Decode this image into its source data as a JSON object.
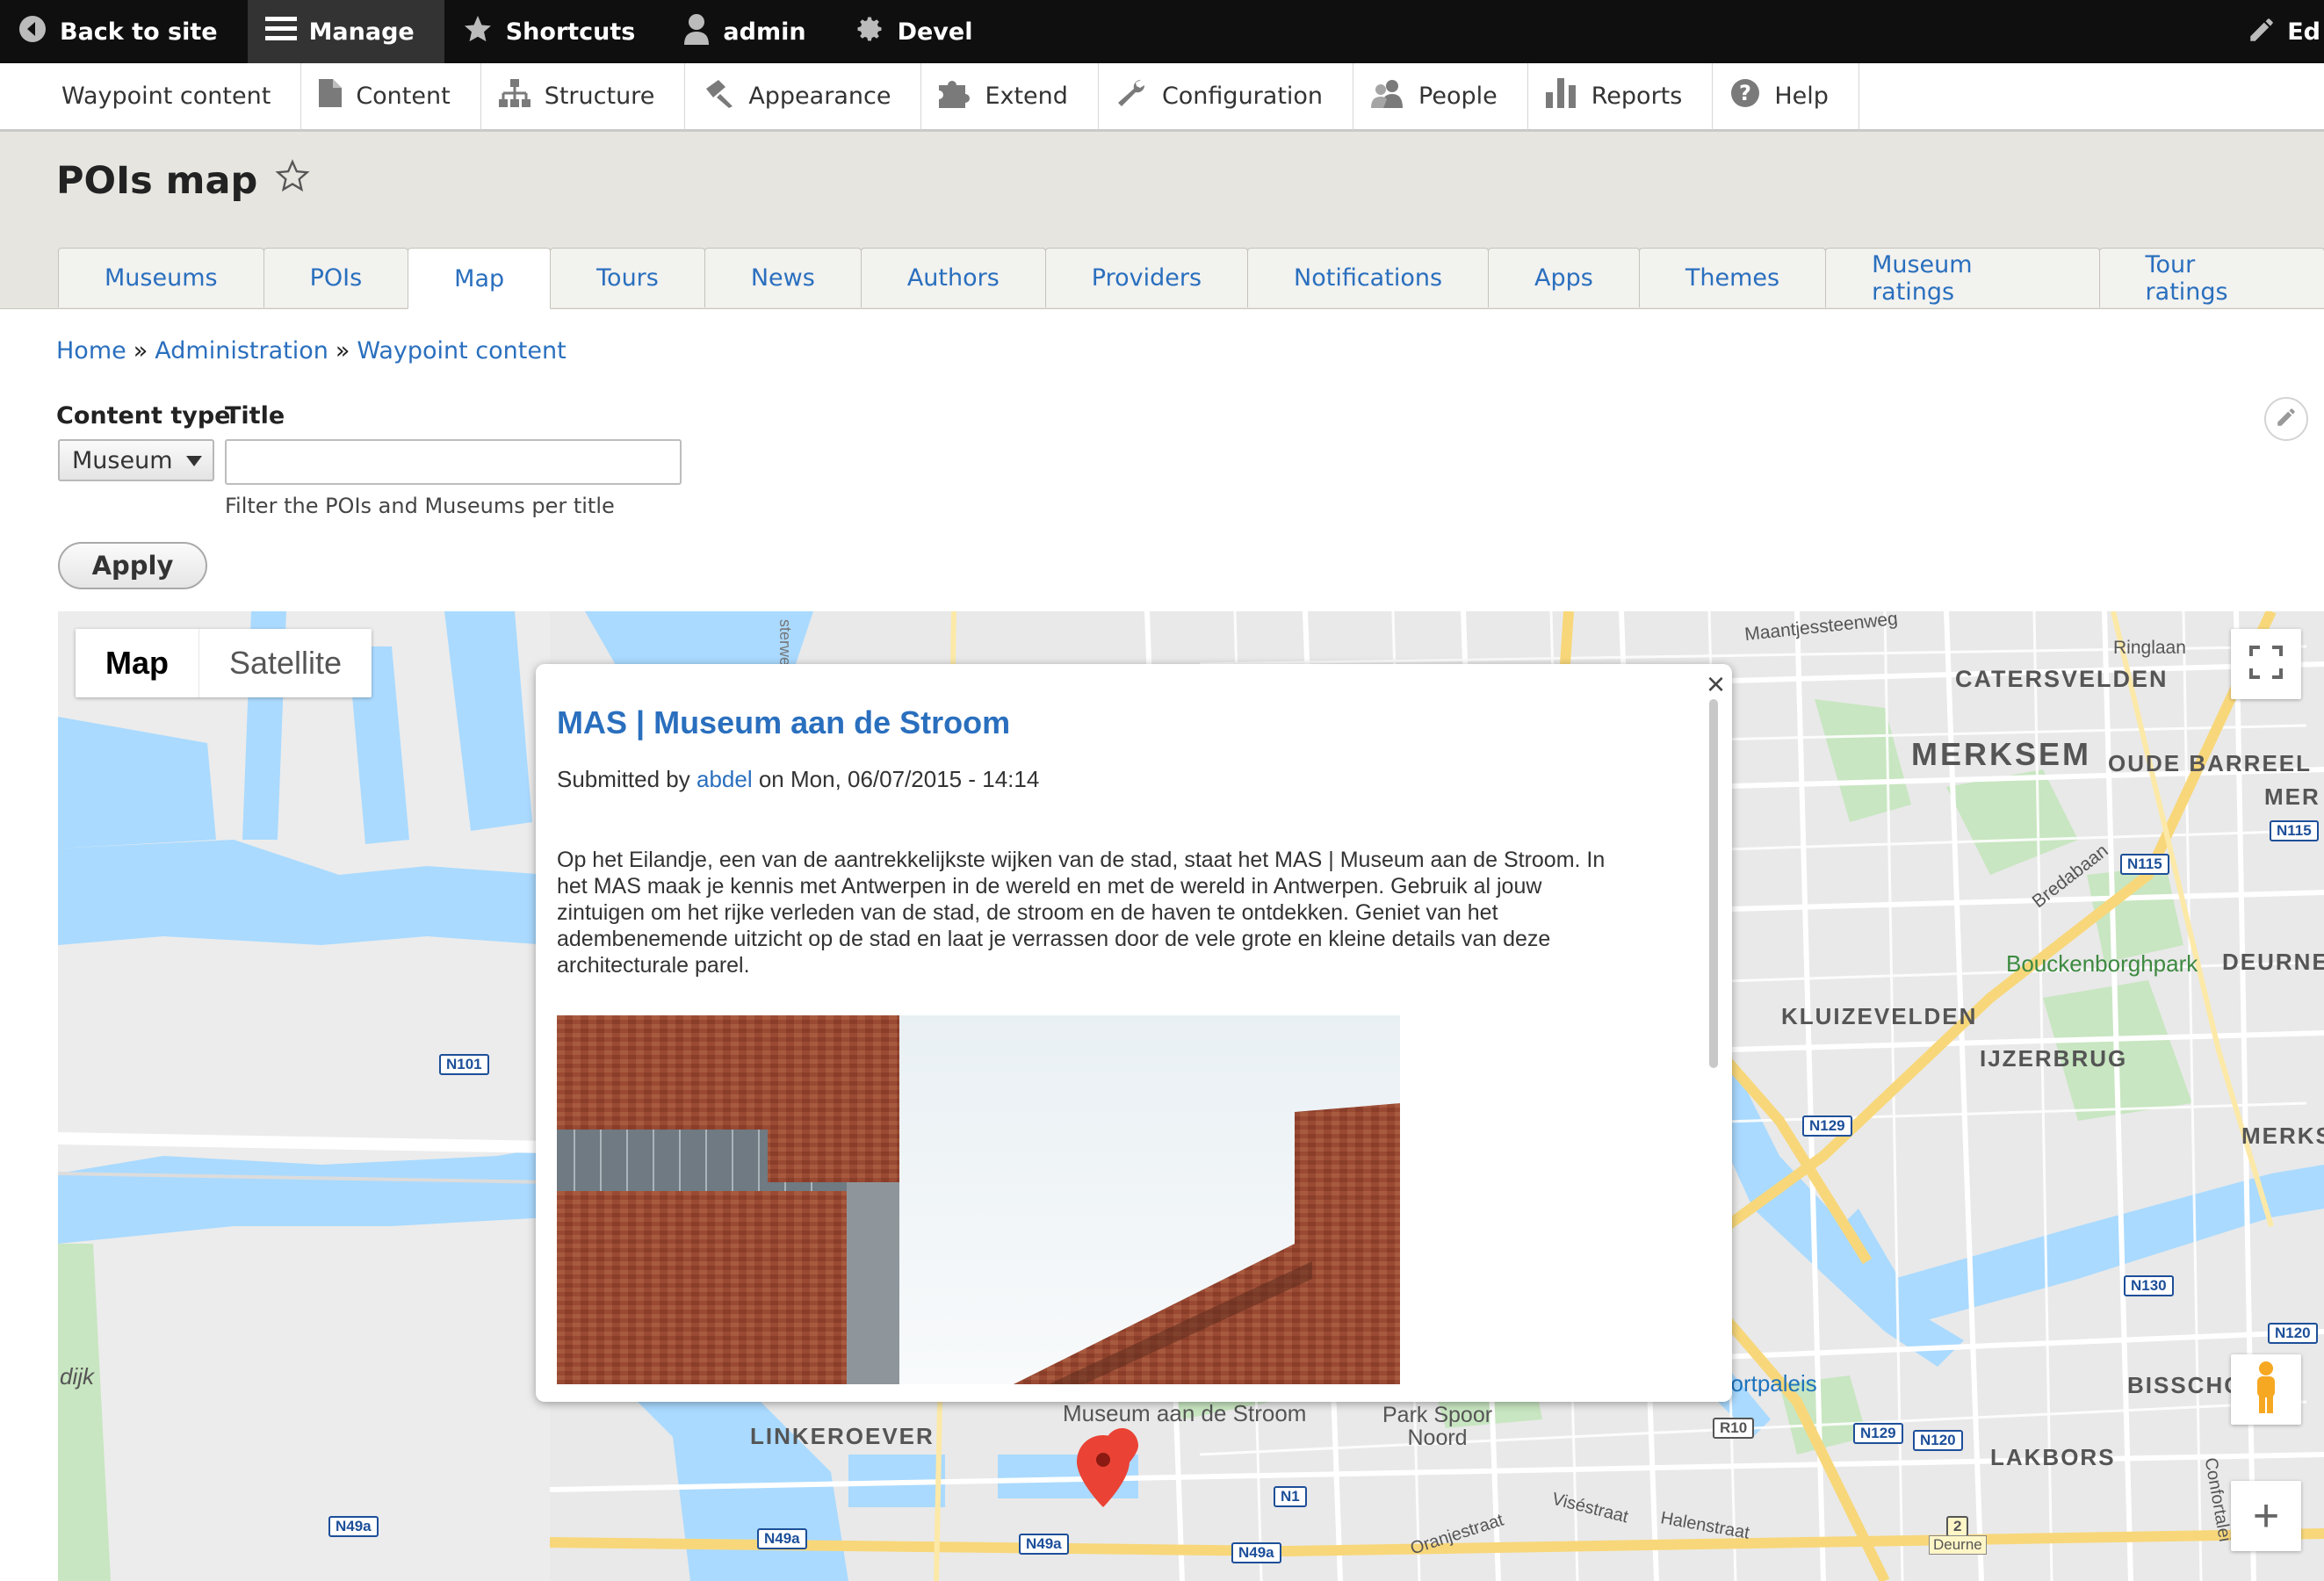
{
  "toolbar": {
    "back_label": "Back to site",
    "manage_label": "Manage",
    "shortcuts_label": "Shortcuts",
    "user_label": "admin",
    "devel_label": "Devel",
    "edit_label": "Ed"
  },
  "menu": {
    "items": [
      {
        "label": "Waypoint content",
        "icon": "none"
      },
      {
        "label": "Content",
        "icon": "file-icon"
      },
      {
        "label": "Structure",
        "icon": "sitemap-icon"
      },
      {
        "label": "Appearance",
        "icon": "paintbrush-icon"
      },
      {
        "label": "Extend",
        "icon": "puzzle-icon"
      },
      {
        "label": "Configuration",
        "icon": "wrench-icon"
      },
      {
        "label": "People",
        "icon": "people-icon"
      },
      {
        "label": "Reports",
        "icon": "bar-chart-icon"
      },
      {
        "label": "Help",
        "icon": "help-icon"
      }
    ]
  },
  "page": {
    "title": "POIs map",
    "tabs": [
      "Museums",
      "POIs",
      "Map",
      "Tours",
      "News",
      "Authors",
      "Providers",
      "Notifications",
      "Apps",
      "Themes",
      "Museum ratings",
      "Tour ratings"
    ],
    "active_tab": "Map"
  },
  "breadcrumb": {
    "home": "Home",
    "admin": "Administration",
    "current": "Waypoint content",
    "sep": "»"
  },
  "filters": {
    "content_type_label": "Content type",
    "content_type_value": "Museum",
    "title_label": "Title",
    "title_value": "",
    "title_description": "Filter the POIs and Museums per title",
    "apply_label": "Apply"
  },
  "map": {
    "type_map": "Map",
    "type_satellite": "Satellite",
    "zoom_in": "+",
    "labels": {
      "maantjessteenweg": "Maantjessteenweg",
      "ringlaan": "Ringlaan",
      "catersvelden": "CATERSVELDEN",
      "merksem": "MERKSEM",
      "oude_barreel": "OUDE BARREEL",
      "mer": "MER",
      "bredabaan": "Bredabaan",
      "bouckenborghpark": "Bouckenborghpark",
      "deurne": "DEURNE",
      "kluizevelden": "KLUIZEVELDEN",
      "ijzerbrug": "IJZERBRUG",
      "merks": "MERKS",
      "sportpaleis": "os Sportpaleis",
      "bissch": "BISSCHO",
      "linkeroever": "LINKEROEVER",
      "museum_aan_de_stroom": "Museum aan de Stroom",
      "park_spoor_noord": "Park Spoor\nNoord",
      "lakbors": "LAKBORS",
      "viseestraat": "Viséstraat",
      "halenstraat": "Halenstraat",
      "oranjestraat": "Oranjestraat",
      "confortalei": "Confortalei",
      "dijk": "dijk",
      "sterweg": "sterweg",
      "deurne_small": "Deurne"
    },
    "shields": [
      "N101",
      "N115",
      "N115",
      "N129",
      "N130",
      "N120",
      "N129",
      "N120",
      "R10",
      "N1",
      "N49a",
      "N49a",
      "N49a",
      "N49a",
      "2"
    ]
  },
  "infowindow": {
    "title": "MAS | Museum aan de Stroom",
    "submitted_prefix": "Submitted by",
    "author": "abdel",
    "submitted_suffix": "on Mon, 06/07/2015 - 14:14",
    "body": "Op het Eilandje, een van de aantrekkelijkste wijken van de stad, staat het MAS | Museum aan de Stroom. In het MAS maak je kennis met Antwerpen in de wereld en met de wereld in Antwerpen. Gebruik al jouw zintuigen om het rijke verleden van de stad, de stroom en de haven te ontdekken. Geniet van het adembenemende uitzicht op de stad en laat je verrassen door de vele grote en kleine details van deze architecturale parel.",
    "close": "×"
  },
  "colors": {
    "link": "#2a6fbe",
    "water": "#aadaff",
    "land": "#e8e8e8",
    "park": "#c8e6c1",
    "highway": "#f8d77a",
    "marker": "#ea4335"
  }
}
